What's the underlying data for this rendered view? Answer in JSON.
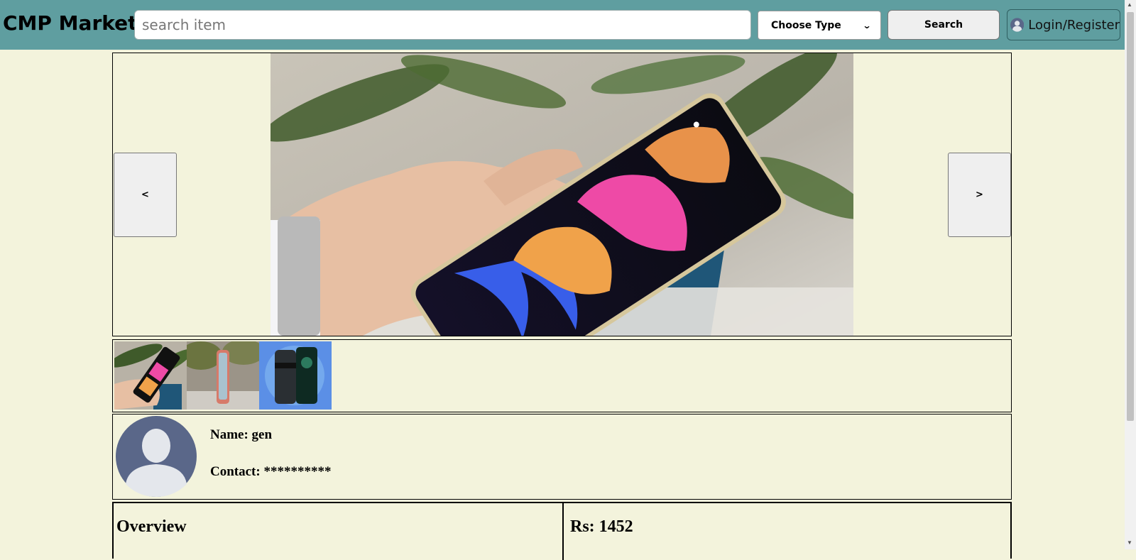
{
  "header": {
    "brand": "CMP Market",
    "search_placeholder": "search item",
    "type_select_value": "Choose Type",
    "search_label": "Search",
    "login_label": "Login/Register",
    "background_color": "#5f9ea0"
  },
  "carousel": {
    "prev_label": "<",
    "next_label": ">",
    "hero_icon": "phone-photo"
  },
  "thumbnails": [
    {
      "icon": "phone-in-hand-thumbnail"
    },
    {
      "icon": "phone-outdoor-thumbnail"
    },
    {
      "icon": "phone-product-thumbnail"
    }
  ],
  "seller": {
    "name_label": "Name: gen",
    "contact_label": "Contact: **********"
  },
  "info": {
    "overview_label": "Overview",
    "price_label": "Rs: 1452"
  },
  "colors": {
    "page_background": "#f3f3dc",
    "accent": "#5f9ea0"
  }
}
